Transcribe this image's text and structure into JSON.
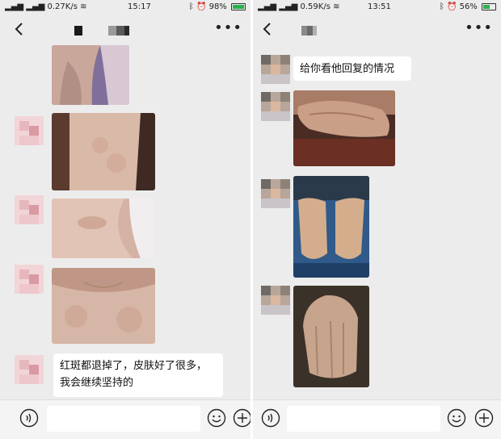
{
  "left": {
    "status": {
      "signal": "⁂⁂|| ⁂⁂||",
      "speed": "0.27K/s",
      "time": "15:17",
      "battery": "98%",
      "battery_level": 0.98
    },
    "messages": {
      "text": [
        "红斑都退掉了，皮肤好了很多，",
        "我会继续坚持的"
      ]
    }
  },
  "right": {
    "status": {
      "signal": "⁂⁂|| ⁂⁂||",
      "speed": "0.59K/s",
      "time": "13:51",
      "battery": "56%",
      "battery_level": 0.56
    },
    "messages": {
      "text": "给你看他回复的情况"
    }
  },
  "colors": {
    "panel_bg": "#ececec",
    "bubble_bg": "#ffffff",
    "battery_green": "#2bb24c"
  },
  "icons": [
    "back-icon",
    "more-icon",
    "voice-icon",
    "emoji-icon",
    "plus-icon",
    "bluetooth-icon",
    "alarm-icon",
    "wifi-icon"
  ]
}
